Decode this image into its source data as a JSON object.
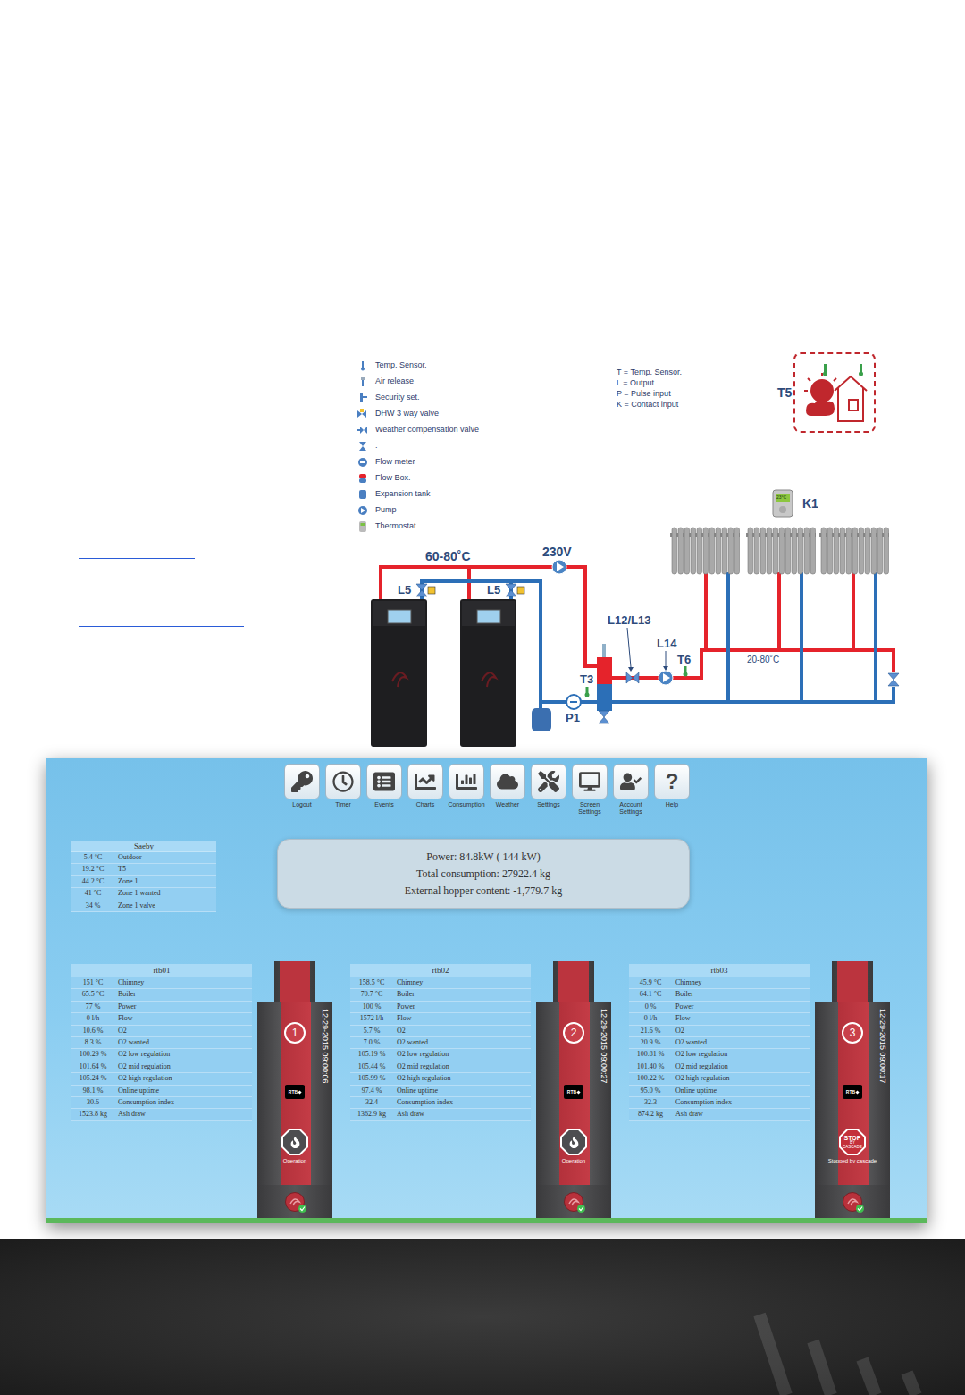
{
  "legend": [
    {
      "label": "Temp. Sensor.",
      "kind": "temp"
    },
    {
      "label": "Air release",
      "kind": "air"
    },
    {
      "label": "Security set.",
      "kind": "security"
    },
    {
      "label": "DHW 3 way valve",
      "kind": "dhw"
    },
    {
      "label": "Weather compensation valve",
      "kind": "weather"
    },
    {
      "label": ".",
      "kind": "valve"
    },
    {
      "label": "Flow meter",
      "kind": "flowmeter"
    },
    {
      "label": "Flow Box.",
      "kind": "flowbox"
    },
    {
      "label": "Expansion tank",
      "kind": "expansion"
    },
    {
      "label": "Pump",
      "kind": "pump"
    },
    {
      "label": "Thermostat",
      "kind": "thermostat"
    }
  ],
  "abbreviations": [
    "T = Temp. Sensor.",
    "L = Output",
    "P = Pulse input",
    "K = Contact input"
  ],
  "diagram": {
    "outdoor_sensor": "T5",
    "supply_temp": "60-80˚C",
    "pump_voltage": "230V",
    "valve_1": "L5",
    "valve_2": "L5",
    "mixing_valve": "L12/L13",
    "circulation_pump": "L14",
    "flow_sensor": "T6",
    "return_sensor": "T3",
    "pulse_meter": "P1",
    "heating_range": "20-80˚C",
    "thermostat": "K1",
    "thermostat_display": "23°C"
  },
  "toolbar": [
    {
      "label": "Logout",
      "kind": "logout"
    },
    {
      "label": "Timer",
      "kind": "timer"
    },
    {
      "label": "Events",
      "kind": "events"
    },
    {
      "label": "Charts",
      "kind": "charts"
    },
    {
      "label": "Consumption",
      "kind": "consumption"
    },
    {
      "label": "Weather",
      "kind": "weather"
    },
    {
      "label": "Settings",
      "kind": "settings"
    },
    {
      "label": "Screen Settings",
      "kind": "screen"
    },
    {
      "label": "Account Settings",
      "kind": "account"
    },
    {
      "label": "Help",
      "kind": "help",
      "glyph": "?"
    }
  ],
  "site": {
    "title": "Saeby",
    "rows": [
      {
        "value": "5.4 °C",
        "label": "Outdoor"
      },
      {
        "value": "19.2 °C",
        "label": "T5"
      },
      {
        "value": "44.2 °C",
        "label": "Zone 1"
      },
      {
        "value": "41 °C",
        "label": "Zone 1 wanted"
      },
      {
        "value": "34 %",
        "label": "Zone 1 valve"
      }
    ]
  },
  "summary": [
    "Power: 84.8kW ( 144 kW)",
    "Total consumption: 27922.4 kg",
    "External hopper content: -1,779.7 kg"
  ],
  "boilers": [
    {
      "name": "rtb01",
      "number": "1",
      "timestamp": "12-29-2015 09:00:06",
      "display": "RTB",
      "kind": "running",
      "status": "Operation",
      "rows": [
        {
          "value": "151 °C",
          "label": "Chimney"
        },
        {
          "value": "65.5 °C",
          "label": "Boiler"
        },
        {
          "value": "77 %",
          "label": "Power"
        },
        {
          "value": "0 l/h",
          "label": "Flow"
        },
        {
          "value": "10.6 %",
          "label": "O2"
        },
        {
          "value": "8.3 %",
          "label": "O2 wanted"
        },
        {
          "value": "100.29 %",
          "label": "O2 low regulation"
        },
        {
          "value": "101.64 %",
          "label": "O2 mid regulation"
        },
        {
          "value": "105.24 %",
          "label": "O2 high regulation"
        },
        {
          "value": "98.1 %",
          "label": "Online uptime"
        },
        {
          "value": "30.6",
          "label": "Consumption index"
        },
        {
          "value": "1523.8 kg",
          "label": "Ash draw"
        }
      ]
    },
    {
      "name": "rtb02",
      "number": "2",
      "timestamp": "12-29-2015 09:00:27",
      "display": "RTB",
      "kind": "running",
      "status": "Operation",
      "rows": [
        {
          "value": "158.5 °C",
          "label": "Chimney"
        },
        {
          "value": "70.7 °C",
          "label": "Boiler"
        },
        {
          "value": "100 %",
          "label": "Power"
        },
        {
          "value": "1572 l/h",
          "label": "Flow"
        },
        {
          "value": "5.7 %",
          "label": "O2"
        },
        {
          "value": "7.0 %",
          "label": "O2 wanted"
        },
        {
          "value": "105.19 %",
          "label": "O2 low regulation"
        },
        {
          "value": "105.44 %",
          "label": "O2 mid regulation"
        },
        {
          "value": "105.99 %",
          "label": "O2 high regulation"
        },
        {
          "value": "97.4 %",
          "label": "Online uptime"
        },
        {
          "value": "32.4",
          "label": "Consumption index"
        },
        {
          "value": "1362.9 kg",
          "label": "Ash draw"
        }
      ]
    },
    {
      "name": "rtb03",
      "number": "3",
      "timestamp": "12-29-2015 09:00:17",
      "display": "RTB",
      "kind": "stopped",
      "status": "Stopped by cascade",
      "sign_lines": [
        "STOP",
        "BY",
        "CASCADE"
      ],
      "rows": [
        {
          "value": "45.9 °C",
          "label": "Chimney"
        },
        {
          "value": "64.1 °C",
          "label": "Boiler"
        },
        {
          "value": "0 %",
          "label": "Power"
        },
        {
          "value": "0 l/h",
          "label": "Flow"
        },
        {
          "value": "21.6 %",
          "label": "O2"
        },
        {
          "value": "20.9 %",
          "label": "O2 wanted"
        },
        {
          "value": "100.81 %",
          "label": "O2 low regulation"
        },
        {
          "value": "101.40 %",
          "label": "O2 mid regulation"
        },
        {
          "value": "100.22 %",
          "label": "O2 high regulation"
        },
        {
          "value": "95.0 %",
          "label": "Online uptime"
        },
        {
          "value": "32.3",
          "label": "Consumption index"
        },
        {
          "value": "874.2 kg",
          "label": "Ash draw"
        }
      ]
    }
  ]
}
